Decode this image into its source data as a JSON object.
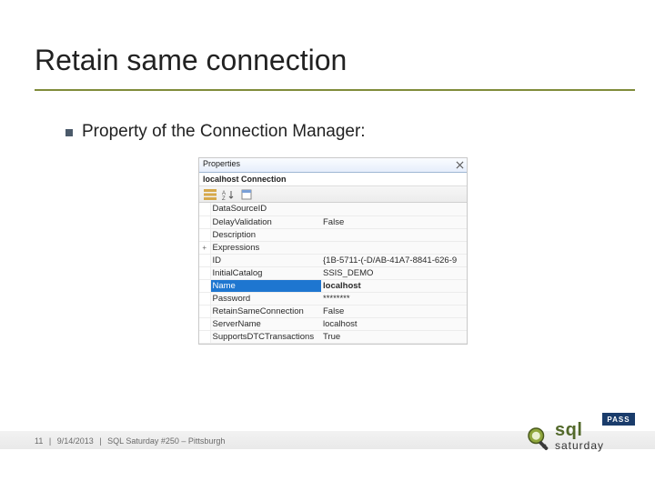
{
  "title": "Retain same connection",
  "bullet": "Property of the Connection Manager:",
  "properties_panel": {
    "header": "Properties",
    "target": "localhost  Connection",
    "rows": [
      {
        "expand": "",
        "name": "DataSourceID",
        "value": ""
      },
      {
        "expand": "",
        "name": "DelayValidation",
        "value": "False"
      },
      {
        "expand": "",
        "name": "Description",
        "value": ""
      },
      {
        "expand": "+",
        "name": "Expressions",
        "value": ""
      },
      {
        "expand": "",
        "name": "ID",
        "value": "{1B-5711-(-D/AB-41A7-8841-626-9"
      },
      {
        "expand": "",
        "name": "InitialCatalog",
        "value": "SSIS_DEMO"
      },
      {
        "expand": "",
        "name": "Name",
        "value": "localhost",
        "selected": true
      },
      {
        "expand": "",
        "name": "Password",
        "value": "********"
      },
      {
        "expand": "",
        "name": "RetainSameConnection",
        "value": "False"
      },
      {
        "expand": "",
        "name": "ServerName",
        "value": "localhost"
      },
      {
        "expand": "",
        "name": "SupportsDTCTransactions",
        "value": "True"
      }
    ]
  },
  "footer": {
    "page": "11",
    "date": "9/14/2013",
    "event": "SQL Saturday #250 – Pittsburgh"
  },
  "logo": {
    "pass": "PASS",
    "sql": "sql",
    "sub": "saturday"
  }
}
